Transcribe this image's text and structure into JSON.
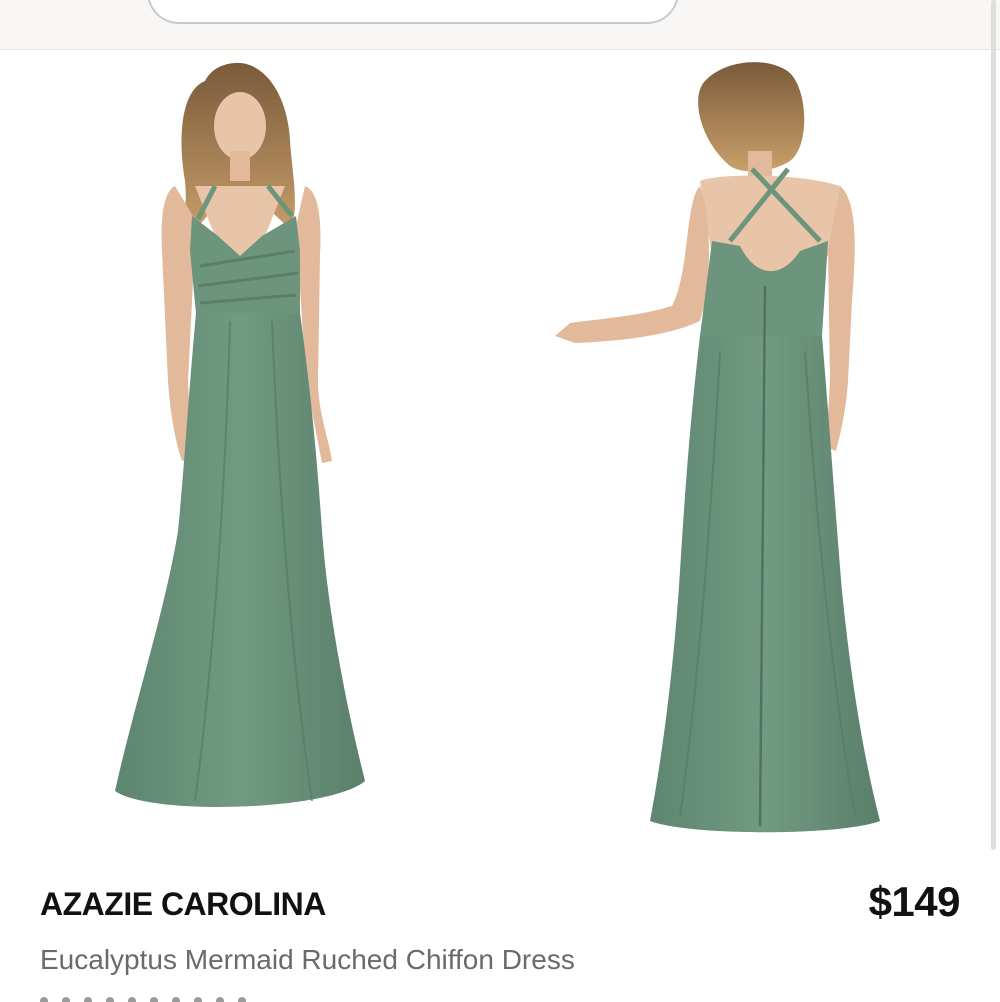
{
  "product": {
    "brand": "AZAZIE CAROLINA",
    "price": "$149",
    "title": "Eucalyptus Mermaid Ruched Chiffon Dress"
  },
  "images": {
    "front_view": "model-front-view",
    "back_view": "model-back-view",
    "dress_color": "#6b917a"
  },
  "colors": {
    "topbar_bg": "#f8f7f5",
    "text_primary": "#111111",
    "text_secondary": "#6a6a6a"
  }
}
